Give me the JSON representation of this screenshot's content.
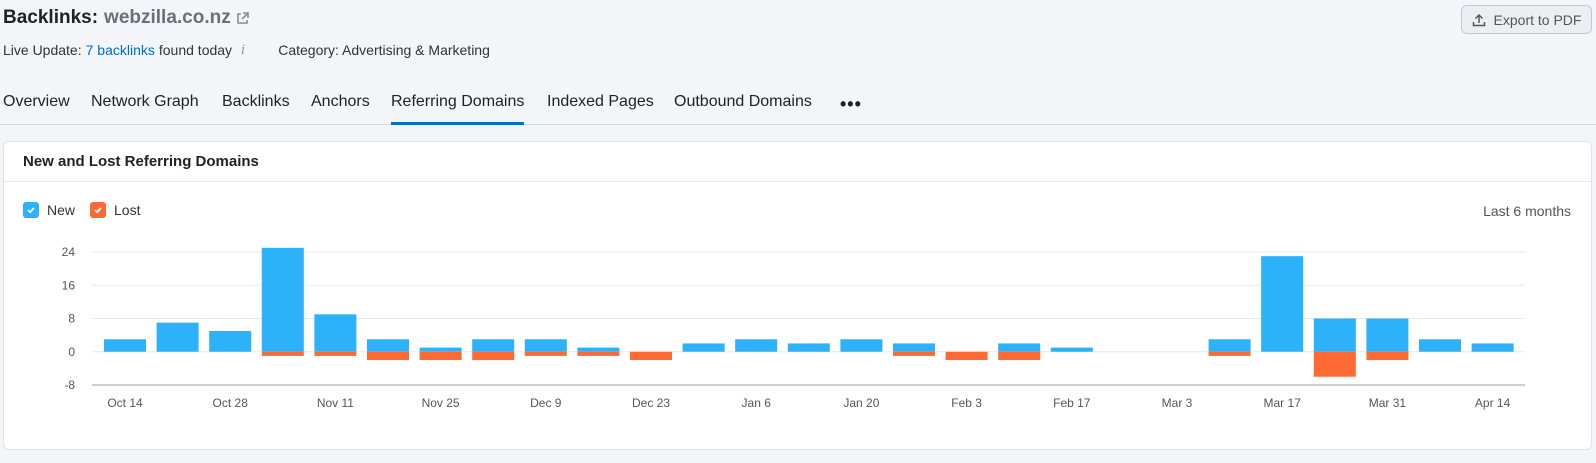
{
  "header": {
    "title_prefix": "Backlinks:",
    "domain": "webzilla.co.nz",
    "export_label": "Export to PDF"
  },
  "live_update": {
    "prefix": "Live Update:",
    "link": "7 backlinks",
    "suffix": "found today",
    "info_glyph": "i",
    "category": "Category: Advertising & Marketing"
  },
  "tabs": [
    {
      "label": "Overview"
    },
    {
      "label": "Network Graph"
    },
    {
      "label": "Backlinks"
    },
    {
      "label": "Anchors"
    },
    {
      "label": "Referring Domains",
      "active": true
    },
    {
      "label": "Indexed Pages"
    },
    {
      "label": "Outbound Domains"
    }
  ],
  "more_glyph": "•••",
  "card": {
    "title": "New and Lost Referring Domains",
    "legend_new": "New",
    "legend_lost": "Lost",
    "range": "Last 6 months"
  },
  "colors": {
    "new": "#2cb1fb",
    "lost": "#ff6932",
    "accent": "#006dca"
  },
  "chart_data": {
    "type": "bar",
    "series": [
      {
        "name": "New",
        "values": [
          3,
          7,
          5,
          25,
          9,
          3,
          1,
          3,
          3,
          1,
          0,
          2,
          3,
          2,
          3,
          2,
          0,
          2,
          1,
          0,
          0,
          3,
          23,
          8,
          8,
          3,
          2
        ]
      },
      {
        "name": "Lost",
        "values": [
          0,
          0,
          0,
          -1,
          -1,
          -2,
          -2,
          -2,
          -1,
          -1,
          -2,
          0,
          0,
          0,
          0,
          -1,
          -2,
          -2,
          0,
          0,
          0,
          -1,
          0,
          -6,
          -2,
          0,
          0
        ]
      }
    ],
    "yticks": [
      24,
      16,
      8,
      0,
      -8
    ],
    "ylim": [
      -8,
      24
    ],
    "xtick_labels": [
      "Oct 14",
      "Oct 28",
      "Nov 11",
      "Nov 25",
      "Dec 9",
      "Dec 23",
      "Jan 6",
      "Jan 20",
      "Feb 3",
      "Feb 17",
      "Mar 3",
      "Mar 17",
      "Mar 31",
      "Apr 14"
    ],
    "grid": true,
    "legend": "top-left"
  }
}
